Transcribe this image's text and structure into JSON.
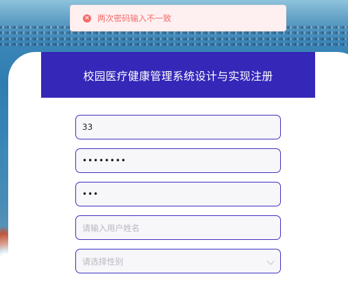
{
  "toast": {
    "message": "两次密码输入不一致",
    "icon": "error-circle-icon",
    "color": "#f56c6c"
  },
  "header": {
    "title": "校园医疗健康管理系统设计与实现注册",
    "background": "#3527b8"
  },
  "form": {
    "username": {
      "value": "33"
    },
    "password": {
      "value": "••••••••"
    },
    "confirm_password": {
      "value": "•••"
    },
    "name": {
      "placeholder": "请输入用户姓名"
    },
    "gender": {
      "placeholder": "请选择性别",
      "icon": "chevron-down-icon"
    }
  }
}
